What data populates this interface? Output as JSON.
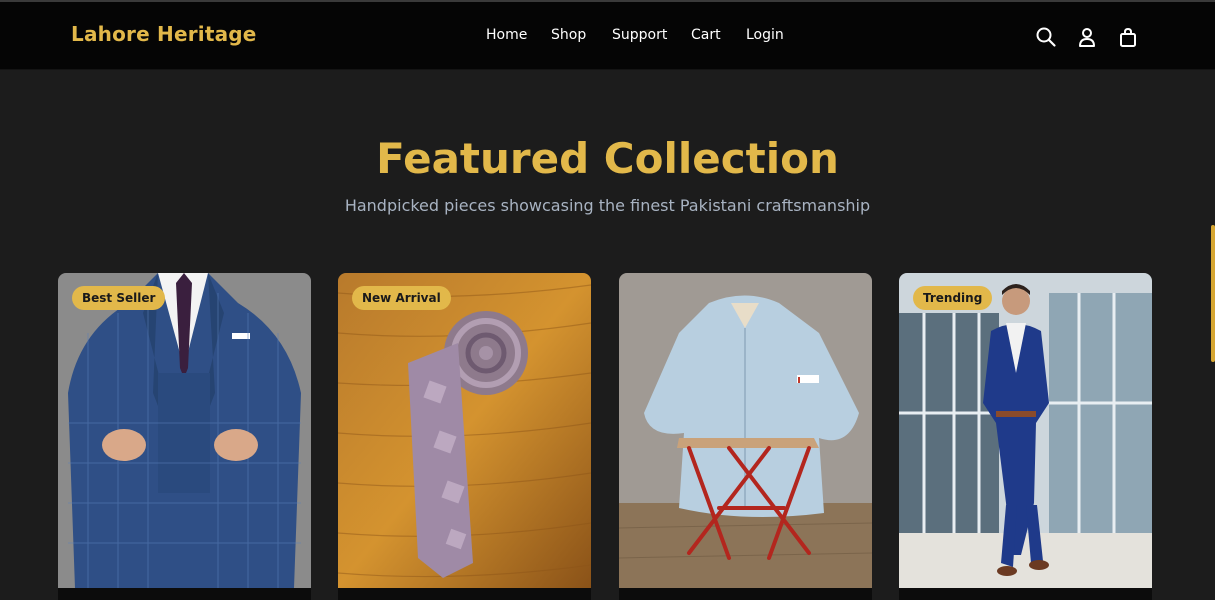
{
  "brand": {
    "name": "Lahore Heritage"
  },
  "nav": {
    "links": [
      {
        "label": "Home"
      },
      {
        "label": "Shop"
      },
      {
        "label": "Support"
      },
      {
        "label": "Cart"
      },
      {
        "label": "Login"
      }
    ],
    "icons": [
      "search-icon",
      "user-icon",
      "shopping-bag-icon"
    ]
  },
  "featured": {
    "title": "Featured Collection",
    "subtitle": "Handpicked pieces showcasing the finest Pakistani craftsmanship",
    "products": [
      {
        "badge": "Best Seller",
        "image": "blue-check-suit-photo"
      },
      {
        "badge": "New Arrival",
        "image": "purple-necktie-photo"
      },
      {
        "badge": "",
        "image": "light-blue-shirt-on-stool-photo"
      },
      {
        "badge": "Trending",
        "image": "navy-suit-model-photo"
      }
    ]
  },
  "colors": {
    "accent": "#e2b84a",
    "nav_background": "#050505",
    "page_background": "#1c1c1c",
    "subtitle": "#a8b3c2"
  }
}
